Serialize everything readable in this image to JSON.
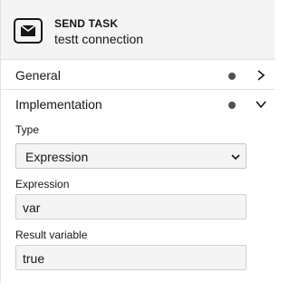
{
  "header": {
    "type": "SEND TASK",
    "name": "testt connection",
    "icon": "envelope-icon"
  },
  "groups": [
    {
      "label": "General",
      "expanded": false,
      "has_entries": true
    },
    {
      "label": "Implementation",
      "expanded": true,
      "has_entries": true
    }
  ],
  "implementation": {
    "type_label": "Type",
    "type_value": "Expression",
    "expression_label": "Expression",
    "expression_value": "var",
    "result_label": "Result variable",
    "result_value": "true"
  }
}
